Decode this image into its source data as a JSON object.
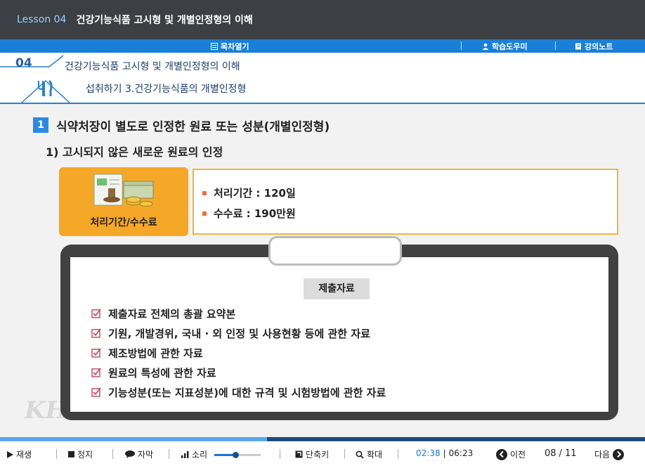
{
  "titlebar": {
    "lesson": "Lesson 04",
    "title": "건강기능식품 고시형 및 개별인정형의 이해"
  },
  "navbar": {
    "toc": "목차열기",
    "helper": "학습도우미",
    "notes": "강의노트"
  },
  "header": {
    "number": "04",
    "title": "건강기능식품 고시형 및 개별인정형의 이해",
    "subtitle": "섭취하기 3.건강기능식품의 개별인정형"
  },
  "content": {
    "section_num": "1",
    "heading": "식약처장이 별도로 인정한 원료 또는 성분(개별인정형)",
    "subheading": "1) 고시되지 않은 새로운 원료의 인정",
    "fee_card": "처리기간/수수료",
    "fee_items": [
      "처리기간 : 120일",
      "수수료 : 190만원"
    ],
    "docs_title": "제출자료",
    "docs": [
      "제출자료 전체의 총괄 요약본",
      "기원, 개발경위, 국내 · 외 인정 및 사용현황 등에 관한 자료",
      "제조방법에 관한 자료",
      "원료의 특성에 관한 자료",
      "기능성분(또는 지표성분)에 대한 규격 및 시험방법에 관한 자료"
    ],
    "watermark": "KHSA"
  },
  "controls": {
    "play": "재생",
    "stop": "정지",
    "caption": "자막",
    "volume": "소리",
    "volume_level": 0.45,
    "shortcut": "단축키",
    "zoom": "확대",
    "time_current": "02:38",
    "time_sep": "|",
    "time_total": "06:23",
    "progress": 0.414,
    "prev": "이전",
    "page_current": "08",
    "page_sep": "/",
    "page_total": "11",
    "next": "다음"
  },
  "colors": {
    "accent": "#1a7fd7",
    "orange": "#f5a727",
    "titlebar": "#3c3f44"
  },
  "icons": {
    "toc": "list-icon",
    "helper": "person-icon",
    "notes": "notebook-icon",
    "header": "fork-knife-icon"
  }
}
